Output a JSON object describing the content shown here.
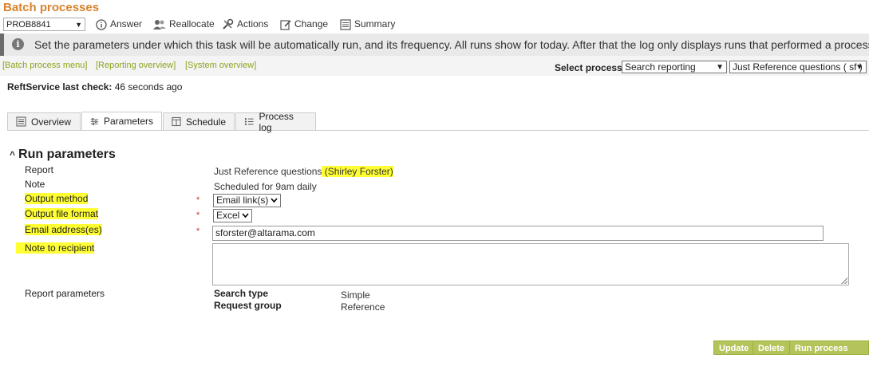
{
  "app": {
    "title": "Batch processes"
  },
  "record_select": {
    "value": "PROB8841"
  },
  "toolbar": {
    "answer": "Answer",
    "reallocate": "Reallocate",
    "actions": "Actions",
    "change": "Change",
    "summary": "Summary"
  },
  "info": {
    "text": "Set the parameters under which this task will be automatically run, and its frequency. All runs show for today. After that the log only displays runs that performed a process."
  },
  "links": {
    "batch_menu": "[Batch process menu]",
    "reporting_overview": "[Reporting overview]",
    "system_overview": "[System overview]"
  },
  "select_process": {
    "label": "Select process",
    "type_value": "Search reporting",
    "report_value": "Just Reference questions ( sf )"
  },
  "service": {
    "label": "ReftService last check:",
    "value": "46 seconds ago"
  },
  "tabs": [
    {
      "label": "Overview",
      "icon": "overview-icon"
    },
    {
      "label": "Parameters",
      "icon": "sliders-icon"
    },
    {
      "label": "Schedule",
      "icon": "schedule-icon"
    },
    {
      "label": "Process log",
      "icon": "list-icon"
    }
  ],
  "section": {
    "title": "Run parameters"
  },
  "fields": {
    "report_label": "Report",
    "report_value": "Just Reference questions",
    "report_owner": " (Shirley Forster)",
    "note_label": "Note",
    "note_value": "Scheduled for 9am daily",
    "output_method_label": "Output method",
    "output_method_value": "Email link(s)",
    "output_format_label": "Output file format",
    "output_format_value": "Excel",
    "email_label": "Email address(es)",
    "email_value": "sforster@altarama.com",
    "note_recipient_label": "Note to recipient",
    "note_recipient_value": "",
    "required_mark": "*"
  },
  "report_parameters": {
    "label": "Report parameters",
    "rows": [
      {
        "key": "Search type",
        "value": "Simple"
      },
      {
        "key": "Request group",
        "value": "Reference"
      }
    ]
  },
  "buttons": {
    "update": "Update",
    "delete": "Delete",
    "run_now": "Run process now"
  },
  "colors": {
    "title": "#d9822b",
    "link": "#8aa61c",
    "button": "#b5c45a",
    "highlight": "#ffff33",
    "required": "#c0392b"
  }
}
